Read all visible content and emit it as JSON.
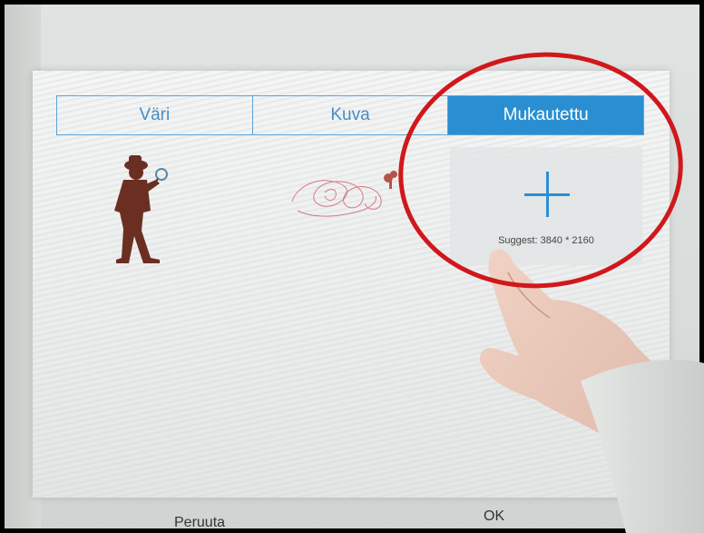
{
  "tabs": [
    {
      "label": "Väri",
      "active": false
    },
    {
      "label": "Kuva",
      "active": false
    },
    {
      "label": "Mukautettu",
      "active": true
    }
  ],
  "custom_tile": {
    "icon": "plus-icon",
    "suggest_text": "Suggest: 3840 * 2160"
  },
  "thumbnails": [
    {
      "icon": "detective-silhouette-icon"
    },
    {
      "icon": "doodle-sketch-icon"
    }
  ],
  "footer": {
    "cancel_label": "Peruuta",
    "ok_label": "OK"
  },
  "colors": {
    "accent": "#2a8fd2",
    "annotation_ring": "#d0181c"
  }
}
